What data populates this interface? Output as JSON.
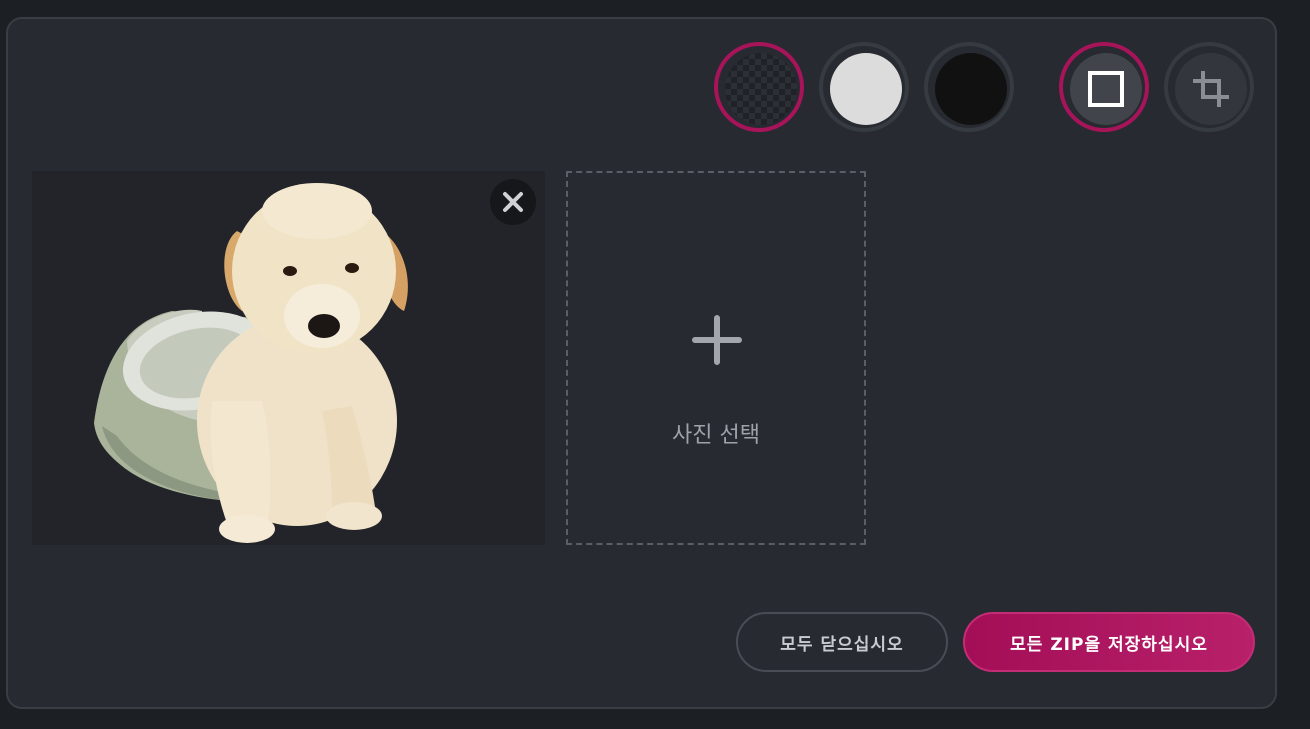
{
  "toolbar": {
    "backgrounds": [
      {
        "name": "transparent",
        "selected": true
      },
      {
        "name": "white",
        "color": "#dcdcdc",
        "selected": false
      },
      {
        "name": "black",
        "color": "#111111",
        "selected": false
      }
    ],
    "modes": [
      {
        "name": "original-size",
        "icon": "square-icon",
        "selected": true
      },
      {
        "name": "crop",
        "icon": "crop-icon",
        "selected": false
      }
    ]
  },
  "image_card": {
    "subject": "puppy-in-bowl",
    "close_icon": "close-icon"
  },
  "add_photo": {
    "icon": "plus-icon",
    "label": "사진 선택"
  },
  "actions": {
    "close_all_label": "모두 닫으십시오",
    "save_zip_label": "모든 ZIP을 저장하십시오"
  },
  "colors": {
    "accent": "#a8145a",
    "panel": "#272a31",
    "page": "#1c1f24"
  }
}
